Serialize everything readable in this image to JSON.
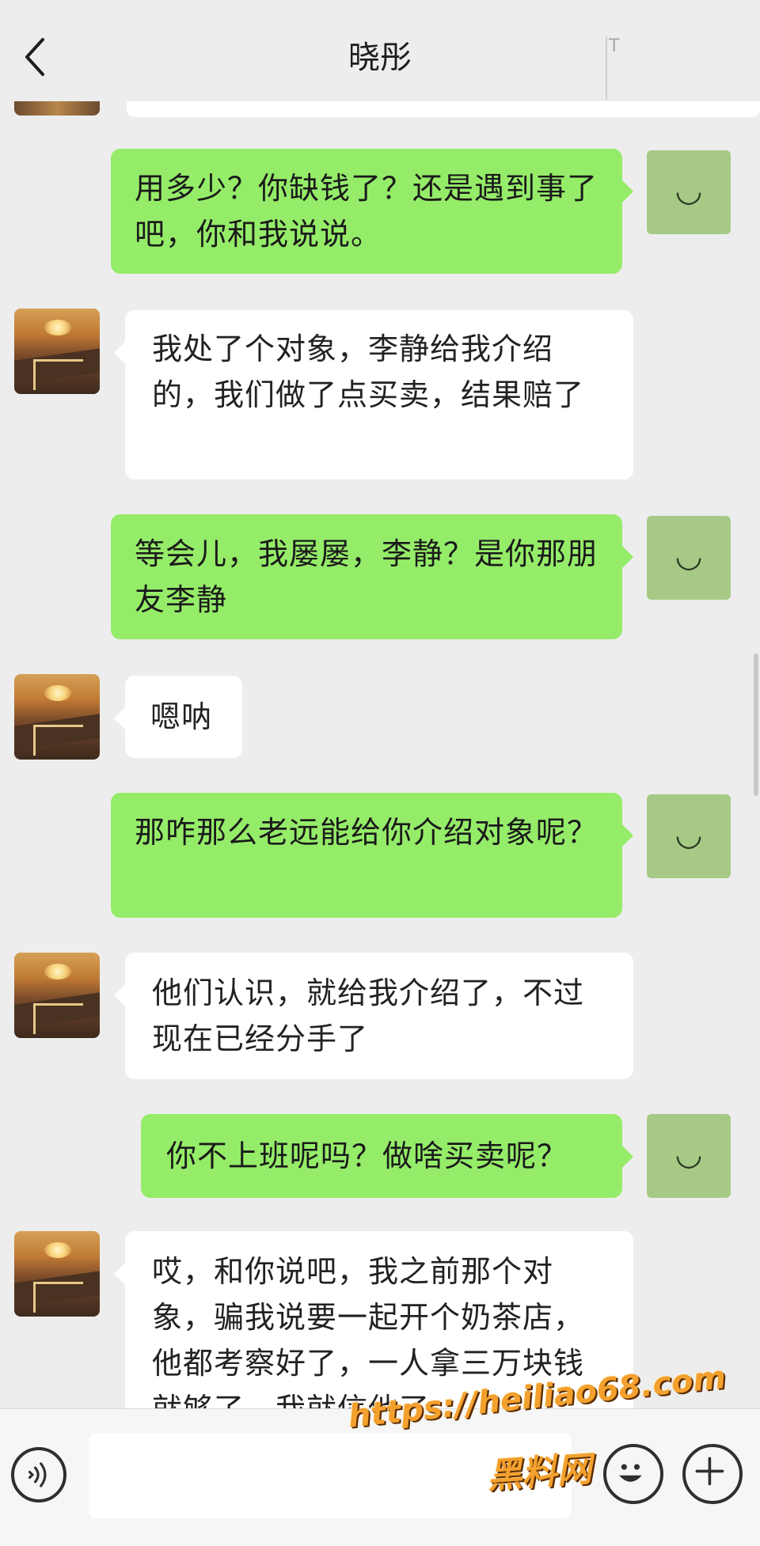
{
  "header": {
    "title": "晓彤",
    "back_icon": "chevron-left-icon",
    "corner_glyph": "T"
  },
  "messages": [
    {
      "side": "out",
      "text": "用多少？你缺钱了？还是遇到事了吧，你和我说说。"
    },
    {
      "side": "in",
      "text": "我处了个对象，李静给我介绍的，我们做了点买卖，结果赔了"
    },
    {
      "side": "out",
      "text": "等会儿，我屡屡，李静？是你那朋友李静"
    },
    {
      "side": "in",
      "text": "嗯呐"
    },
    {
      "side": "out",
      "text": "那咋那么老远能给你介绍对象呢？"
    },
    {
      "side": "in",
      "text": "他们认识，就给我介绍了，不过现在已经分手了"
    },
    {
      "side": "out",
      "text": "你不上班呢吗？做啥买卖呢？"
    },
    {
      "side": "in",
      "text": "哎，和你说吧，我之前那个对象，骗我说要一起开个奶茶店，他都考察好了，一人拿三万块钱就够了，我就信他了"
    }
  ],
  "sent_avatar_glyph": "◡",
  "input_bar": {
    "voice_icon": "voice-icon",
    "emoji_icon": "emoji-icon",
    "add_icon": "plus-icon",
    "input_value": ""
  },
  "watermark": {
    "url": "https://heiliao68.com",
    "name": "黑料网"
  },
  "colors": {
    "background": "#ededed",
    "sent_bubble": "#95ec69",
    "received_bubble": "#ffffff",
    "sent_avatar": "#a6ca86",
    "watermark": "#f3a02e"
  }
}
